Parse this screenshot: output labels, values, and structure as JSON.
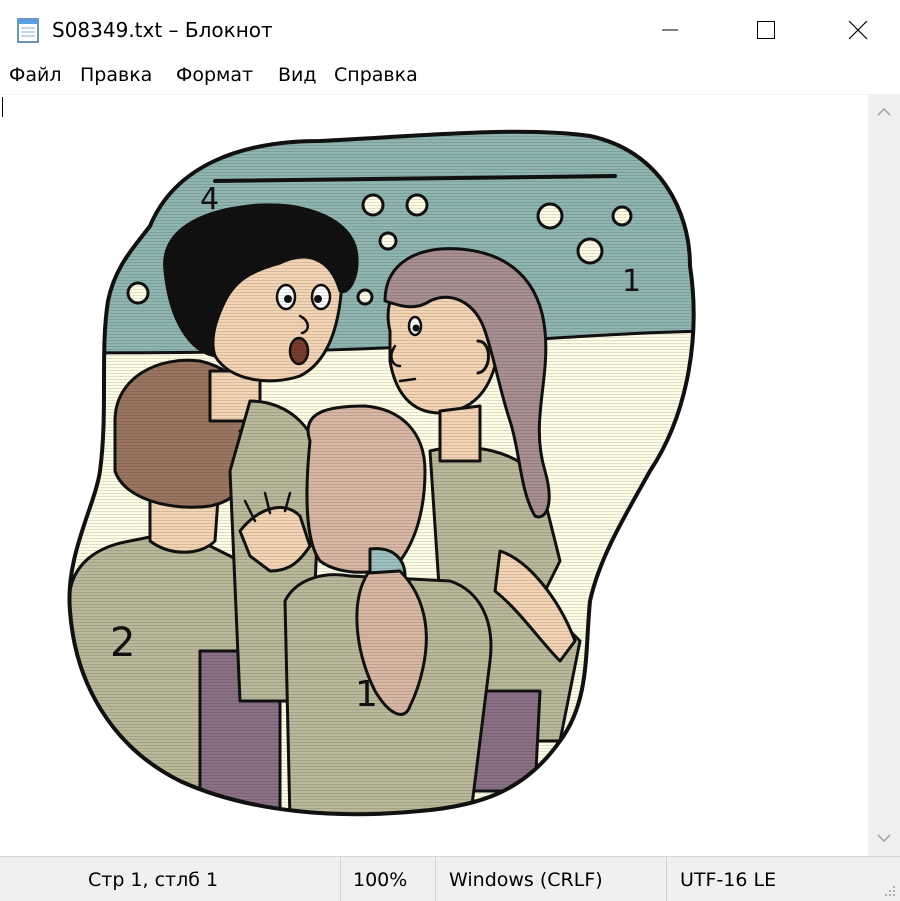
{
  "window": {
    "title": "S08349.txt – Блокнот",
    "icons": [
      "notepad-icon",
      "minimize-icon",
      "maximize-icon",
      "close-icon"
    ]
  },
  "menu": {
    "items": [
      "Файл",
      "Правка",
      "Формат",
      "Вид",
      "Справка"
    ]
  },
  "content": {
    "illustration": "children-in-team-shirts",
    "shirt_numbers": [
      "4",
      "1",
      "2",
      "1"
    ]
  },
  "status": {
    "position": "Стр 1, стлб 1",
    "zoom": "100%",
    "line_endings": "Windows (CRLF)",
    "encoding": "UTF-16 LE"
  },
  "colors": {
    "sky": "#8fb5b0",
    "wall": "#fdfde6",
    "shirt": "#b9b89a",
    "skin": "#f3d4b4",
    "shorts": "#8a7186",
    "hair_brown": "#9a7660",
    "hair_long": "#a89090",
    "hair_light": "#d8b8a4",
    "hair_black": "#111111",
    "band": "#9ec2c2"
  }
}
